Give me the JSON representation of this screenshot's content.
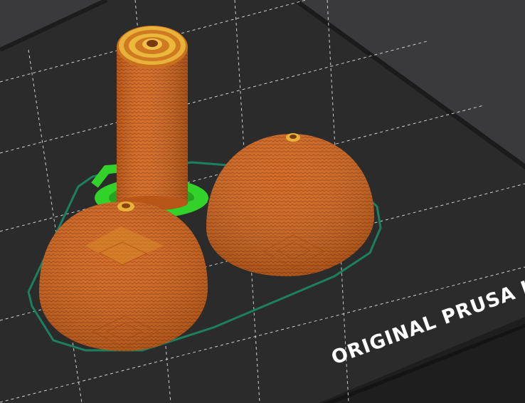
{
  "app": {
    "view": "3D preview",
    "colors": {
      "background": "#3a3a3c",
      "bed_surface": "#2a2a2b",
      "bed_edge": "#1b1b1c",
      "grid_line": "#d8d8d8",
      "print_orange": "#d2661e",
      "print_top": "#e8b23a",
      "support_green": "#2fd02a",
      "skirt": "#1a7f5c"
    }
  },
  "bed": {
    "brand_label": "ORIGINAL PRUSA I"
  },
  "objects": [
    {
      "name": "cylinder",
      "material_color": "print_orange"
    },
    {
      "name": "dome-left",
      "material_color": "print_orange"
    },
    {
      "name": "dome-right",
      "material_color": "print_orange"
    }
  ]
}
